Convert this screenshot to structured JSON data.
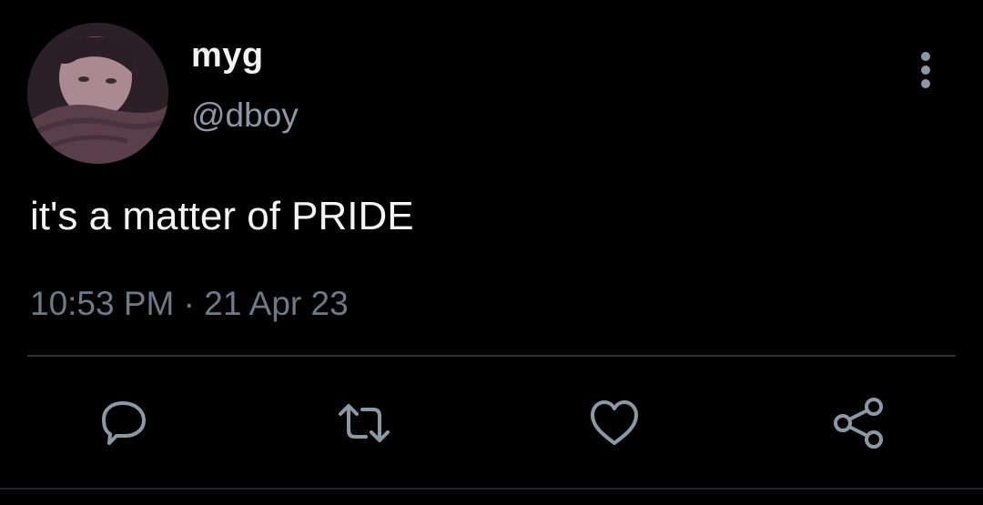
{
  "user": {
    "display_name": "myg",
    "handle": "@dboy"
  },
  "tweet": {
    "text": "it's a matter of PRIDE",
    "timestamp": "10:53 PM · 21 Apr 23"
  },
  "actions": [
    {
      "icon": "reply-icon"
    },
    {
      "icon": "retweet-icon"
    },
    {
      "icon": "like-icon"
    },
    {
      "icon": "share-icon"
    }
  ],
  "colors": {
    "background": "#000000",
    "text_primary": "#f4f4f4",
    "text_secondary": "#8b98a5",
    "divider": "#2f3336"
  }
}
